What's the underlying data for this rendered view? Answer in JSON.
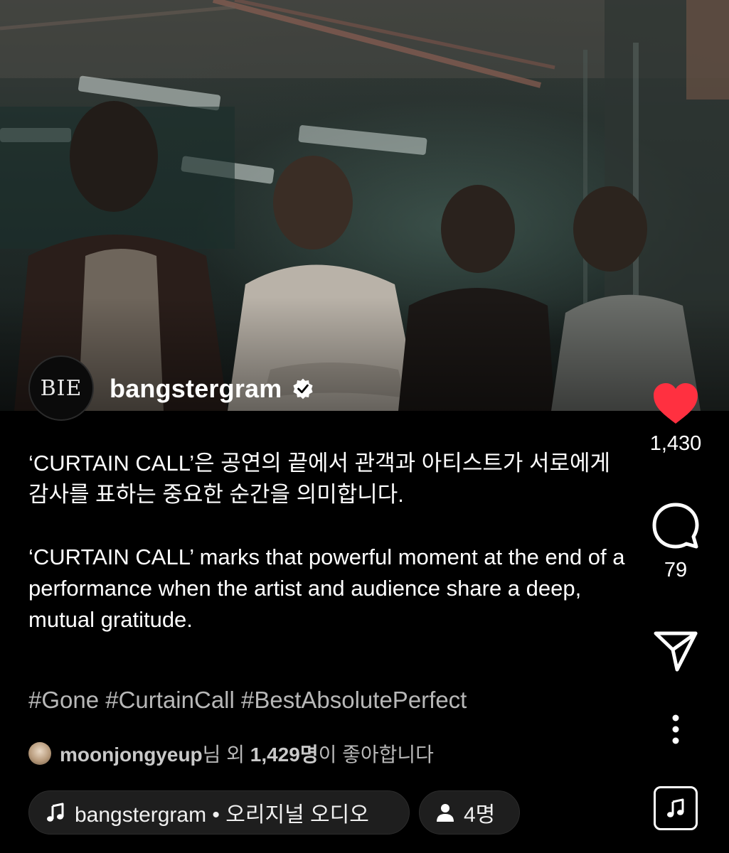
{
  "post": {
    "username": "bangstergram",
    "avatar_logo_text": "BIE",
    "caption_ko": "‘CURTAIN CALL’은 공연의 끝에서 관객과 아티스트가 서로에게 감사를 표하는 중요한 순간을 의미합니다.",
    "caption_en": "‘CURTAIN CALL’ marks that powerful moment at the end of a performance when the artist and audience share a deep, mutual gratitude.",
    "hashtags": "#Gone #CurtainCall #BestAbsolutePerfect"
  },
  "likes": {
    "first_user": "moonjongyeup",
    "suffix_1": "님 외 ",
    "count_text": "1,429명",
    "suffix_2": "이 좋아합니다"
  },
  "actions": {
    "like_count": "1,430",
    "comment_count": "79"
  },
  "audio": {
    "label": "bangstergram • 오리지널 오디오"
  },
  "people": {
    "label": "4명"
  },
  "colors": {
    "like_red": "#ff3040",
    "background": "#000000",
    "muted_text": "#b8b8b8"
  },
  "icons": [
    "heart-icon",
    "comment-icon",
    "share-icon",
    "more-icon",
    "music-note-icon",
    "person-icon",
    "verified-icon"
  ]
}
